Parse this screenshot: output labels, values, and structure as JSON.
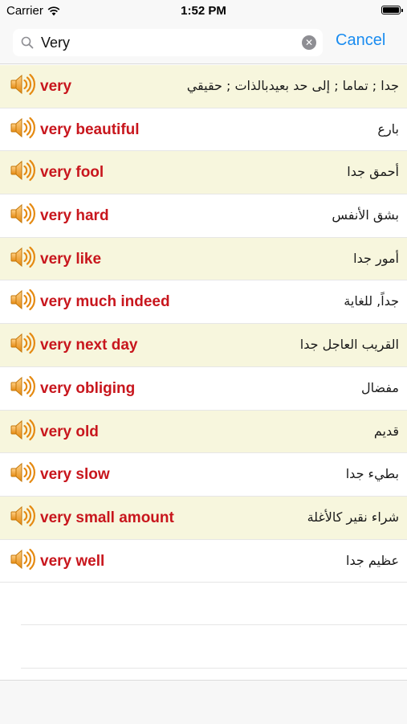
{
  "status_bar": {
    "carrier": "Carrier",
    "time": "1:52 PM"
  },
  "search": {
    "query": "Very",
    "cancel_label": "Cancel"
  },
  "colors": {
    "accent": "#1a8cf0",
    "english_text": "#c8161d",
    "alt_row": "#f7f6dd"
  },
  "icons": {
    "row_icon": "speaker-icon",
    "search_icon": "search-icon",
    "clear_icon": "clear-icon",
    "wifi_icon": "wifi-icon",
    "battery_icon": "battery-icon"
  },
  "results": [
    {
      "en": "very",
      "ar": "جدا ; تماما ; إلى حد بعيدبالذات ; حقيقي"
    },
    {
      "en": "very beautiful",
      "ar": "بارع"
    },
    {
      "en": "very fool",
      "ar": "أحمق جدا"
    },
    {
      "en": "very hard",
      "ar": "بشق الأنفس"
    },
    {
      "en": "very like",
      "ar": "أمور جدا"
    },
    {
      "en": "very much indeed",
      "ar": "جداً, للغاية"
    },
    {
      "en": "very next day",
      "ar": "القريب العاجل جدا"
    },
    {
      "en": "very obliging",
      "ar": "مفضال"
    },
    {
      "en": "very old",
      "ar": "قديم"
    },
    {
      "en": "very slow",
      "ar": "بطيء جدا"
    },
    {
      "en": "very small amount",
      "ar": "شراء نقير كالأغلة"
    },
    {
      "en": "very well",
      "ar": "عظيم جدا"
    }
  ]
}
